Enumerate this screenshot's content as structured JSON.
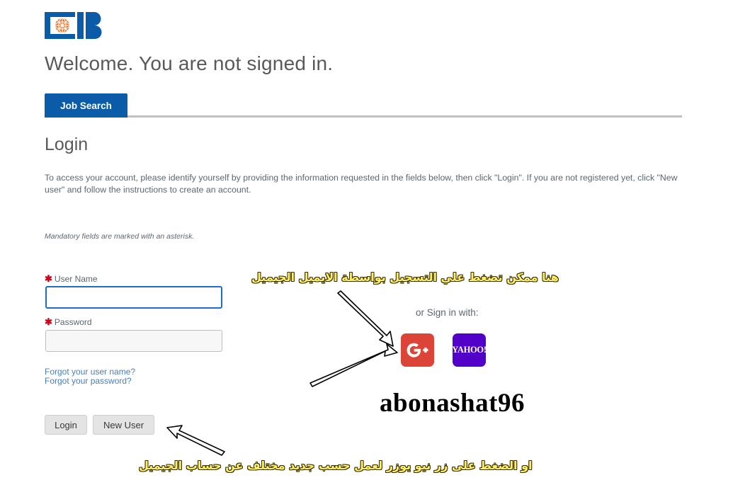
{
  "branding": {
    "logo_name": "cib-logo",
    "logo_letters": "IB",
    "logo_blue": "#0a5ca8",
    "logo_orange": "#e8782d"
  },
  "header": {
    "welcome": "Welcome. You are not signed in."
  },
  "tabs": [
    {
      "label": "Job Search",
      "active": true
    }
  ],
  "login": {
    "title": "Login",
    "intro": "To access your account, please identify yourself by providing the information requested in the fields below, then click \"Login\". If you are not registered yet, click \"New user\" and follow the instructions to create an account.",
    "mandatory_note": "Mandatory fields are marked with an asterisk.",
    "asterisk": "✱",
    "fields": {
      "username": {
        "label": "User Name",
        "value": "",
        "placeholder": ""
      },
      "password": {
        "label": "Password",
        "value": "",
        "placeholder": ""
      }
    },
    "links": {
      "forgot_username": "Forgot your user name?",
      "forgot_password": "Forgot your password?"
    },
    "buttons": {
      "login": "Login",
      "new_user": "New User"
    }
  },
  "social": {
    "label": "or Sign in with:",
    "providers": [
      {
        "name": "google-plus",
        "text": "G+",
        "color": "#db4437"
      },
      {
        "name": "yahoo",
        "text": "YAHOO!",
        "color": "#5201c8"
      }
    ]
  },
  "annotations": {
    "top_arabic": "هنا ممكن تضغط علي التسجيل بواسطة الايميل الجيميل",
    "bottom_arabic": "او الضغط على زر نيو يوزر لعمل حسب جديد مختلف عن حساب الجيميل",
    "watermark": "abonashat96",
    "highlight_color": "#ffef66"
  }
}
